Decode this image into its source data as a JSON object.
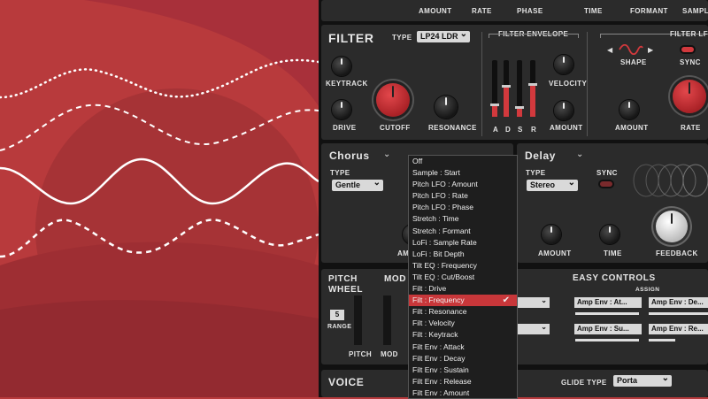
{
  "colors": {
    "accent": "#d2393d",
    "panel": "#2b2b2b",
    "background": "#b83a3c"
  },
  "top_strip": {
    "labels": [
      "AMOUNT",
      "RATE",
      "PHASE",
      "TIME",
      "FORMANT",
      "SAMPL"
    ]
  },
  "filter": {
    "title": "FILTER",
    "type_label": "TYPE",
    "type_value": "LP24 LDR",
    "knobs": [
      "KEYTRACK",
      "DRIVE",
      "CUTOFF",
      "RESONANCE"
    ],
    "envelope": {
      "title": "FILTER ENVELOPE",
      "sliders": [
        "A",
        "D",
        "S",
        "R"
      ],
      "levels": [
        0.2,
        0.55,
        0.15,
        0.6
      ],
      "velocity_label": "VELOCITY",
      "amount_label": "AMOUNT"
    },
    "lfo": {
      "title": "FILTER LF",
      "shape_label": "SHAPE",
      "sync_label": "SYNC",
      "amount_label": "AMOUNT",
      "rate_label": "RATE"
    }
  },
  "chorus": {
    "title": "Chorus",
    "type_label": "TYPE",
    "type_value": "Gentle",
    "amount_label": "AM"
  },
  "delay": {
    "title": "Delay",
    "type_label": "TYPE",
    "type_value": "Stereo",
    "sync_label": "SYNC",
    "knobs": [
      "AMOUNT",
      "TIME",
      "FEEDBACK"
    ]
  },
  "mod_menu": {
    "items": [
      "Off",
      "Sample : Start",
      "Pitch LFO : Amount",
      "Pitch LFO : Rate",
      "Pitch LFO : Phase",
      "Stretch : Time",
      "Stretch : Formant",
      "LoFi : Sample Rate",
      "LoFi : Bit Depth",
      "Tilt EQ : Frequency",
      "Tilt EQ : Cut/Boost",
      "Filt : Drive",
      "Filt : Frequency",
      "Filt : Resonance",
      "Filt : Velocity",
      "Filt : Keytrack",
      "Filt Env : Attack",
      "Filt Env : Decay",
      "Filt Env : Sustain",
      "Filt Env : Release",
      "Filt Env : Amount"
    ],
    "selected_index": 12,
    "check_icon": "checkmark-icon"
  },
  "pitch_wheel": {
    "title_line1": "PITCH",
    "title_line2": "WHEEL",
    "range_value": "5",
    "range_label": "RANGE",
    "pitch_label": "PITCH"
  },
  "mod_wheel": {
    "title": "MOD",
    "mod_label": "MOD"
  },
  "easy_controls": {
    "title": "EASY CONTROLS",
    "assign_label": "ASSIGN",
    "slots": [
      "Amp Env : At...",
      "Amp Env : De...",
      "Amp Env : Su...",
      "Amp Env : Re..."
    ]
  },
  "voice": {
    "title": "VOICE",
    "glide_label": "GLIDE TYPE",
    "glide_value": "Porta"
  }
}
